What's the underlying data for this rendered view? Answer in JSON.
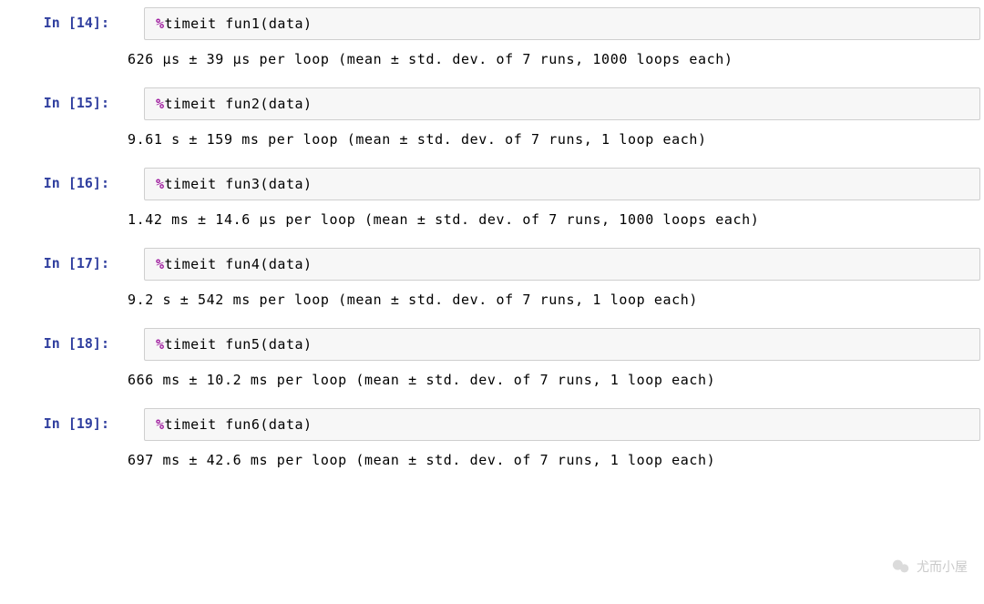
{
  "cells": [
    {
      "prompt": "In [14]:",
      "magic": "%",
      "cmd": "timeit",
      "func": "fun1",
      "arg": "data",
      "output": "626 µs ± 39 µs per loop (mean ± std. dev. of 7 runs, 1000 loops each)"
    },
    {
      "prompt": "In [15]:",
      "magic": "%",
      "cmd": "timeit",
      "func": "fun2",
      "arg": "data",
      "output": "9.61 s ± 159 ms per loop (mean ± std. dev. of 7 runs, 1 loop each)"
    },
    {
      "prompt": "In [16]:",
      "magic": "%",
      "cmd": "timeit",
      "func": "fun3",
      "arg": "data",
      "output": "1.42 ms ± 14.6 µs per loop (mean ± std. dev. of 7 runs, 1000 loops each)"
    },
    {
      "prompt": "In [17]:",
      "magic": "%",
      "cmd": "timeit",
      "func": "fun4",
      "arg": "data",
      "output": "9.2 s ± 542 ms per loop (mean ± std. dev. of 7 runs, 1 loop each)"
    },
    {
      "prompt": "In [18]:",
      "magic": "%",
      "cmd": "timeit",
      "func": "fun5",
      "arg": "data",
      "output": "666 ms ± 10.2 ms per loop (mean ± std. dev. of 7 runs, 1 loop each)"
    },
    {
      "prompt": "In [19]:",
      "magic": "%",
      "cmd": "timeit",
      "func": "fun6",
      "arg": "data",
      "output": "697 ms ± 42.6 ms per loop (mean ± std. dev. of 7 runs, 1 loop each)"
    }
  ],
  "watermark": "尤而小屋"
}
